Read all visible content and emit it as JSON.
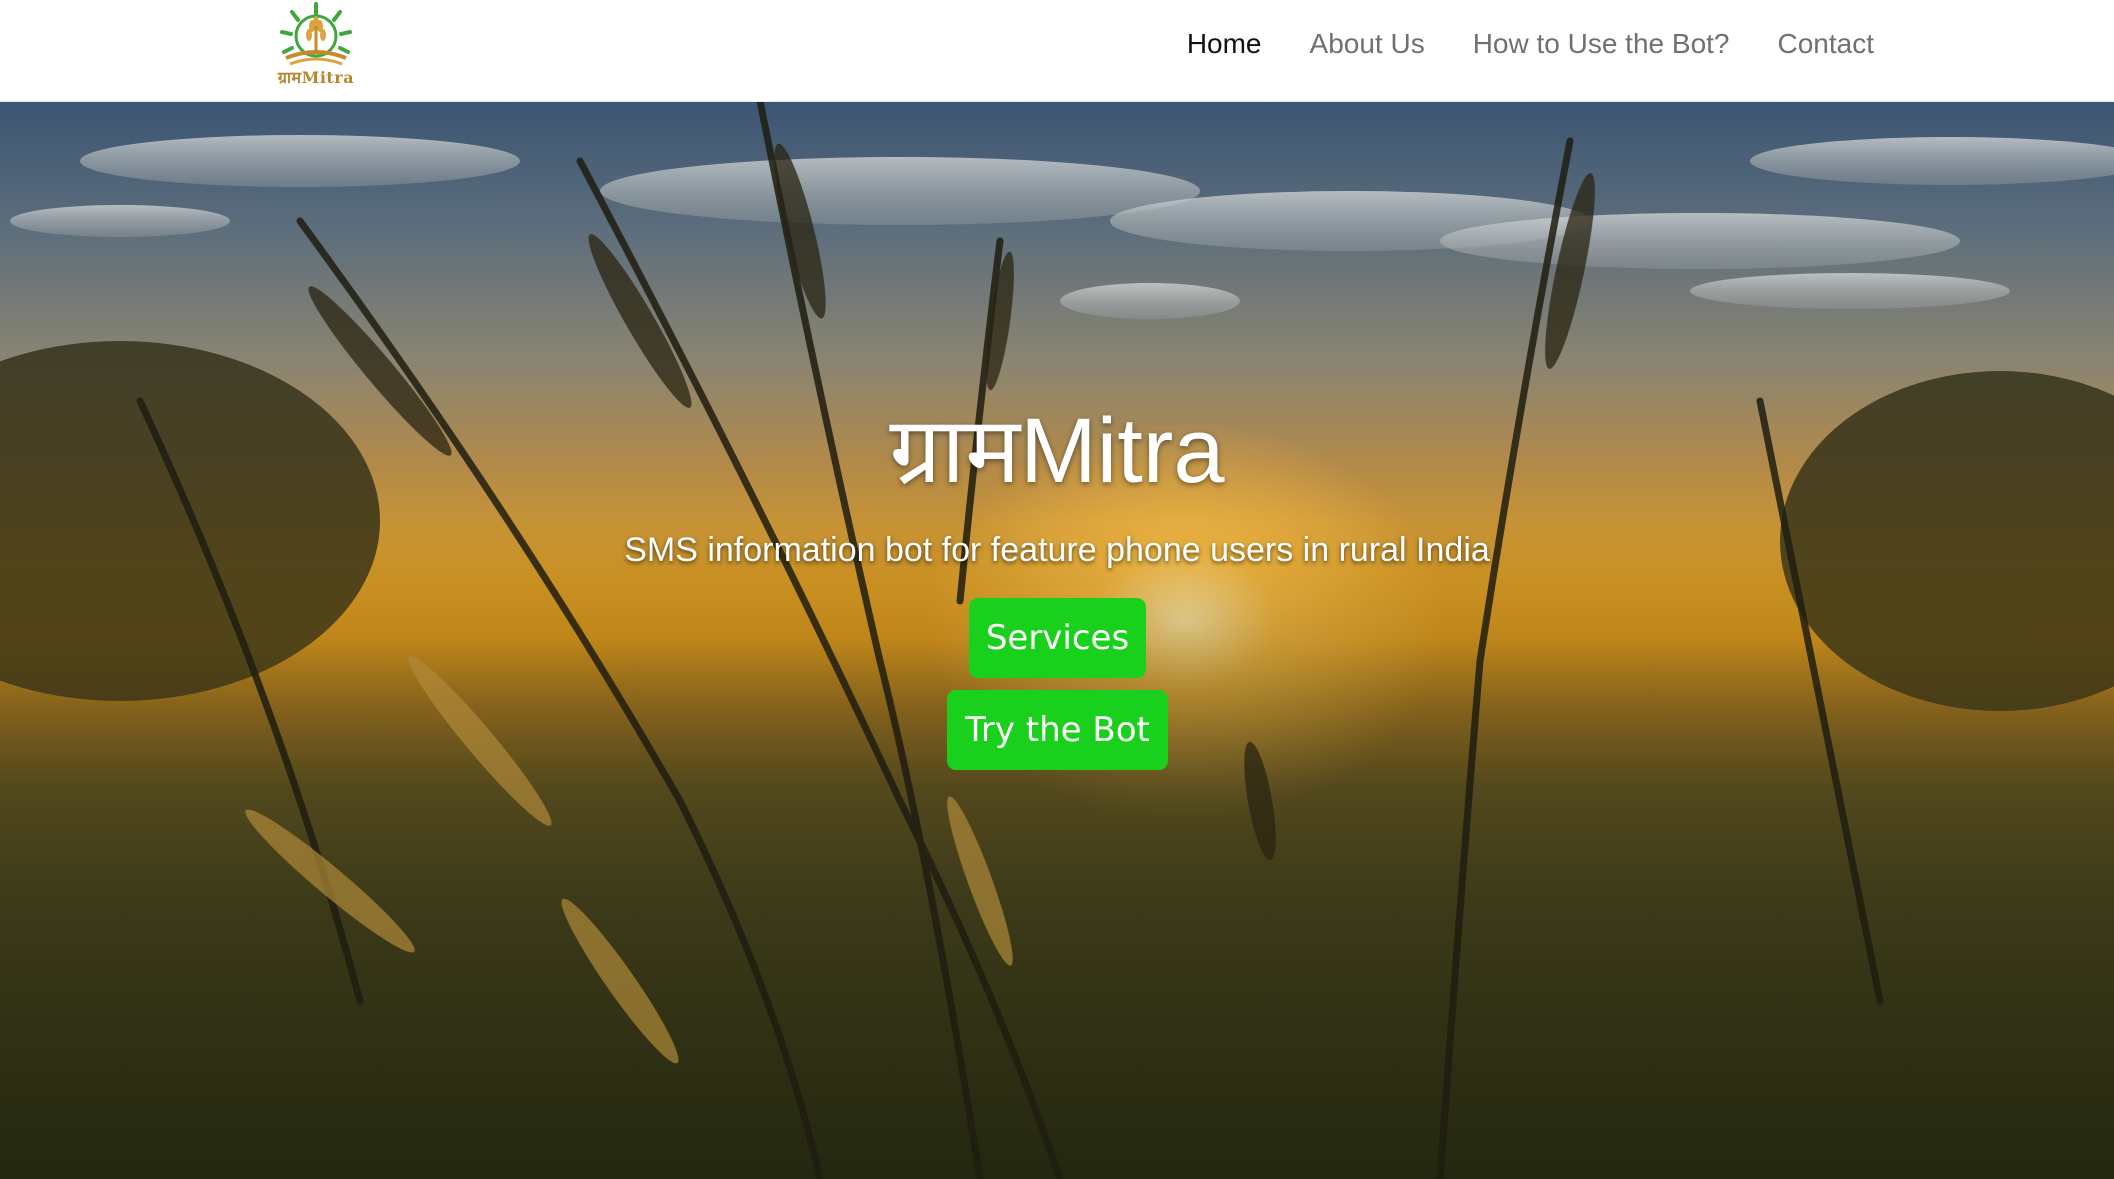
{
  "header": {
    "logo_text": "ग्रामMitra",
    "nav": [
      {
        "label": "Home",
        "active": true
      },
      {
        "label": "About Us",
        "active": false
      },
      {
        "label": "How to Use the Bot?",
        "active": false
      },
      {
        "label": "Contact",
        "active": false
      }
    ]
  },
  "hero": {
    "title": "ग्रामMitra",
    "subtitle": "SMS information bot for feature phone users in rural India",
    "services_button": "Services",
    "try_button": "Try the Bot",
    "button_color": "#19d11c"
  }
}
